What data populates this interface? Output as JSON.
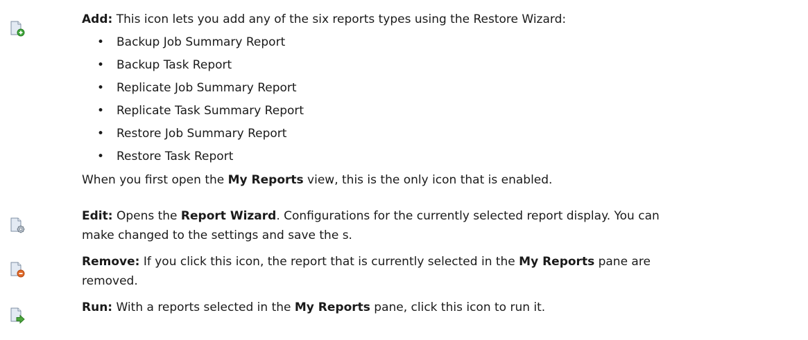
{
  "items": [
    {
      "icon": "add-report-icon",
      "term": "Add:",
      "text": " This icon lets you add any of the six reports types using the Restore Wizard:",
      "bullets": [
        "Backup Job Summary Report",
        "Backup Task Report",
        "Replicate Job Summary Report",
        "Replicate Task Summary Report",
        "Restore Job Summary Report",
        "Restore Task Report"
      ],
      "after_1": "When you first open the ",
      "after_b": "My Reports",
      "after_2": " view, this is the only icon that is enabled."
    },
    {
      "icon": "edit-report-icon",
      "term": "Edit:",
      "t1": " Opens the ",
      "b1": "Report Wizard",
      "t2": ". Configurations for the currently selected report display. You can",
      "line2": "make changed to the settings and save the s."
    },
    {
      "icon": "remove-report-icon",
      "term": "Remove:",
      "t1": " If you click this icon, the report that is currently selected in the ",
      "b1": "My Reports",
      "t2": " pane are",
      "line2": "removed."
    },
    {
      "icon": "run-report-icon",
      "term": "Run:",
      "t1": " With a reports selected in the ",
      "b1": "My Reports",
      "t2": " pane, click this icon to run it."
    }
  ],
  "colors": {
    "icon_body": "#dfe7f1",
    "add_badge": "#3fa63a",
    "edit_badge": "#8a96a3",
    "remove_badge": "#e06a2a",
    "run_badge": "#4da63d"
  }
}
